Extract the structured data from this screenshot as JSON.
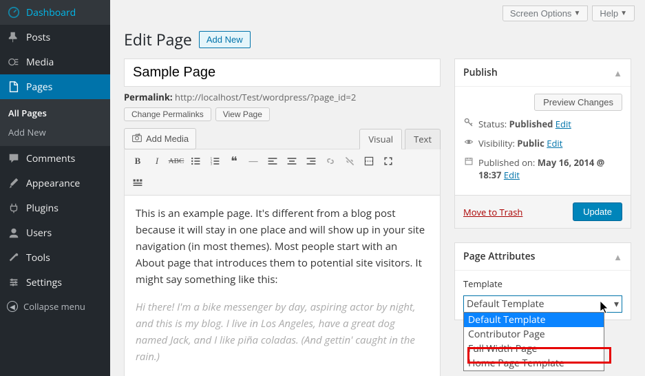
{
  "sidebar": {
    "items": [
      {
        "label": "Dashboard",
        "icon": "dashboard"
      },
      {
        "label": "Posts",
        "icon": "pin"
      },
      {
        "label": "Media",
        "icon": "media"
      },
      {
        "label": "Pages",
        "icon": "page",
        "active": true
      },
      {
        "label": "Comments",
        "icon": "comment"
      },
      {
        "label": "Appearance",
        "icon": "brush"
      },
      {
        "label": "Plugins",
        "icon": "plug"
      },
      {
        "label": "Users",
        "icon": "user"
      },
      {
        "label": "Tools",
        "icon": "wrench"
      },
      {
        "label": "Settings",
        "icon": "gear"
      }
    ],
    "sub_items": [
      "All Pages",
      "Add New"
    ],
    "collapse": "Collapse menu"
  },
  "topbar": {
    "screen_options": "Screen Options",
    "help": "Help"
  },
  "heading": {
    "title": "Edit Page",
    "add_new": "Add New"
  },
  "editor": {
    "title_value": "Sample Page",
    "permalink_label": "Permalink:",
    "permalink_url": "http://localhost/Test/wordpress/?page_id=2",
    "change_permalinks": "Change Permalinks",
    "view_page": "View Page",
    "add_media": "Add Media",
    "tab_visual": "Visual",
    "tab_text": "Text",
    "body_p1": "This is an example page. It's different from a blog post because it will stay in one place and will show up in your site navigation (in most themes). Most people start with an About page that introduces them to potential site visitors. It might say something like this:",
    "body_quote": "Hi there! I'm a bike messenger by day, aspiring actor by night, and this is my blog. I live in Los Angeles, have a great dog named Jack, and I like piña coladas. (And gettin' caught in the rain.)"
  },
  "publish": {
    "title": "Publish",
    "preview": "Preview Changes",
    "status_label": "Status:",
    "status_value": "Published",
    "visibility_label": "Visibility:",
    "visibility_value": "Public",
    "published_label": "Published on:",
    "published_value": "May 16, 2014 @ 18:37",
    "edit": "Edit",
    "trash": "Move to Trash",
    "update": "Update"
  },
  "attributes": {
    "title": "Page Attributes",
    "template_label": "Template",
    "selected": "Default Template",
    "options": [
      "Default Template",
      "Contributor Page",
      "Full Width Page",
      "Home Page Template"
    ]
  }
}
